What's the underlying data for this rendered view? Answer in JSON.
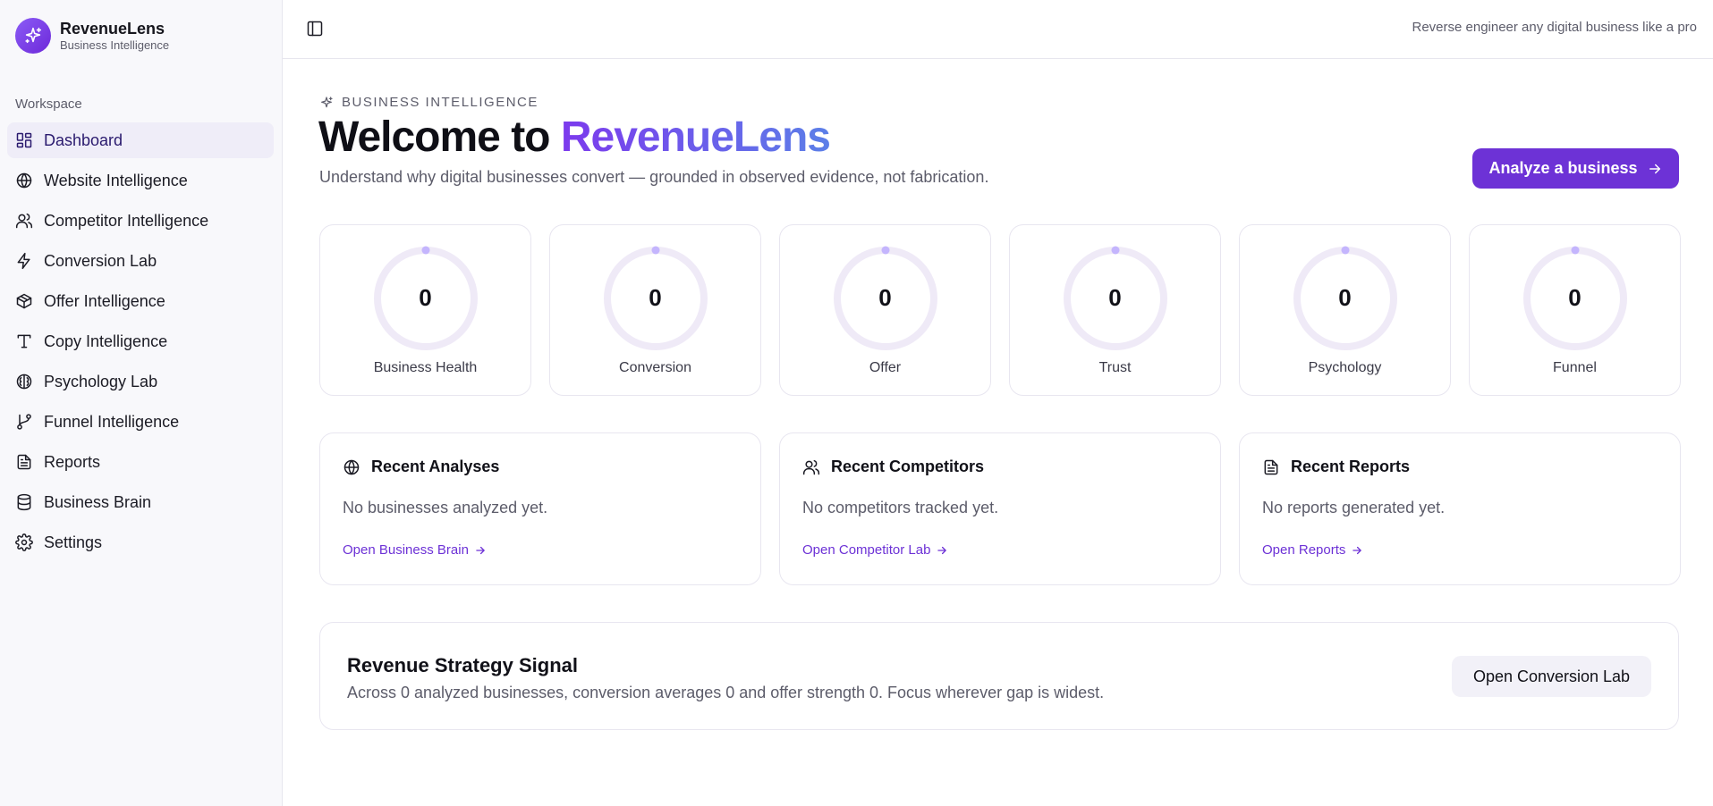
{
  "app": {
    "name": "RevenueLens",
    "subtitle": "Business Intelligence"
  },
  "sidebar": {
    "section_label": "Workspace",
    "items": [
      {
        "label": "Dashboard",
        "icon": "dashboard-icon",
        "active": true
      },
      {
        "label": "Website Intelligence",
        "icon": "globe-icon"
      },
      {
        "label": "Competitor Intelligence",
        "icon": "users-icon"
      },
      {
        "label": "Conversion Lab",
        "icon": "lightning-icon"
      },
      {
        "label": "Offer Intelligence",
        "icon": "package-icon"
      },
      {
        "label": "Copy Intelligence",
        "icon": "type-icon"
      },
      {
        "label": "Psychology Lab",
        "icon": "brain-icon"
      },
      {
        "label": "Funnel Intelligence",
        "icon": "git-branch-icon"
      },
      {
        "label": "Reports",
        "icon": "file-text-icon"
      },
      {
        "label": "Business Brain",
        "icon": "database-icon"
      },
      {
        "label": "Settings",
        "icon": "gear-icon"
      }
    ]
  },
  "topbar": {
    "tagline": "Reverse engineer any digital business like a pro"
  },
  "hero": {
    "eyebrow": "BUSINESS INTELLIGENCE",
    "title_prefix": "Welcome to ",
    "title_accent": "RevenueLens",
    "subtitle": "Understand why digital businesses convert — grounded in observed evidence, not fabrication.",
    "cta_label": "Analyze a business"
  },
  "scores": [
    {
      "label": "Business Health",
      "value": "0",
      "progress": 0
    },
    {
      "label": "Conversion",
      "value": "0",
      "progress": 0
    },
    {
      "label": "Offer",
      "value": "0",
      "progress": 0
    },
    {
      "label": "Trust",
      "value": "0",
      "progress": 0
    },
    {
      "label": "Psychology",
      "value": "0",
      "progress": 0
    },
    {
      "label": "Funnel",
      "value": "0",
      "progress": 0
    }
  ],
  "recent": [
    {
      "title": "Recent Analyses",
      "icon": "globe-icon",
      "empty": "No businesses analyzed yet.",
      "link": "Open Business Brain"
    },
    {
      "title": "Recent Competitors",
      "icon": "users-icon",
      "empty": "No competitors tracked yet.",
      "link": "Open Competitor Lab"
    },
    {
      "title": "Recent Reports",
      "icon": "file-text-icon",
      "empty": "No reports generated yet.",
      "link": "Open Reports"
    }
  ],
  "strategy": {
    "title": "Revenue Strategy Signal",
    "description": "Across 0 analyzed businesses, conversion averages 0 and offer strength 0. Focus wherever gap is widest.",
    "button": "Open Conversion Lab"
  },
  "colors": {
    "accent": "#6d32d6",
    "ring_track": "#efeaf7",
    "ring_dot": "#c4b5fd"
  }
}
